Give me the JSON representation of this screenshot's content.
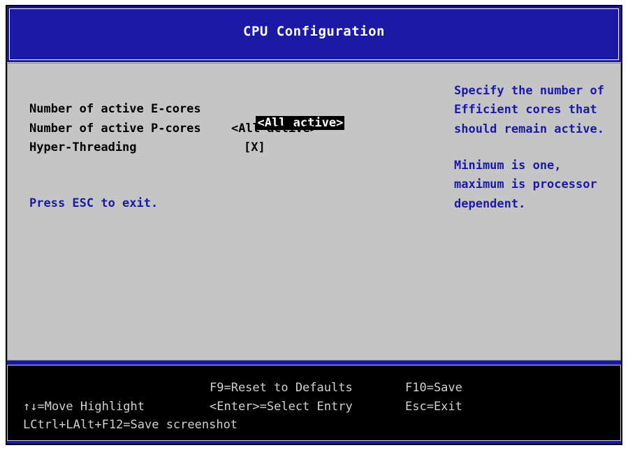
{
  "header": {
    "title": "CPU Configuration"
  },
  "options": [
    {
      "label": "Number of active E-cores",
      "value": "<All active>",
      "selected": true
    },
    {
      "label": "Number of active P-cores",
      "value": "<All active>",
      "selected": false
    },
    {
      "label": "Hyper-Threading",
      "value": "[X]",
      "selected": false
    }
  ],
  "esc_hint": "Press ESC to exit.",
  "help": {
    "lines": [
      "Specify the number of",
      "Efficient cores that",
      "should remain active.",
      "",
      "Minimum is one,",
      "maximum is processor",
      "dependent."
    ]
  },
  "footer": {
    "reset_defaults": "F9=Reset to Defaults",
    "save": "F10=Save",
    "move_highlight": "↑↓=Move Highlight",
    "select_entry": "<Enter>=Select Entry",
    "exit": "Esc=Exit",
    "screenshot": "LCtrl+LAlt+F12=Save screenshot"
  },
  "colors": {
    "header_bg": "#1a1aa6",
    "main_bg": "#c5c5c5",
    "help_text": "#1a1aa6",
    "footer_bg": "#000000",
    "footer_text": "#d0d0d0"
  }
}
